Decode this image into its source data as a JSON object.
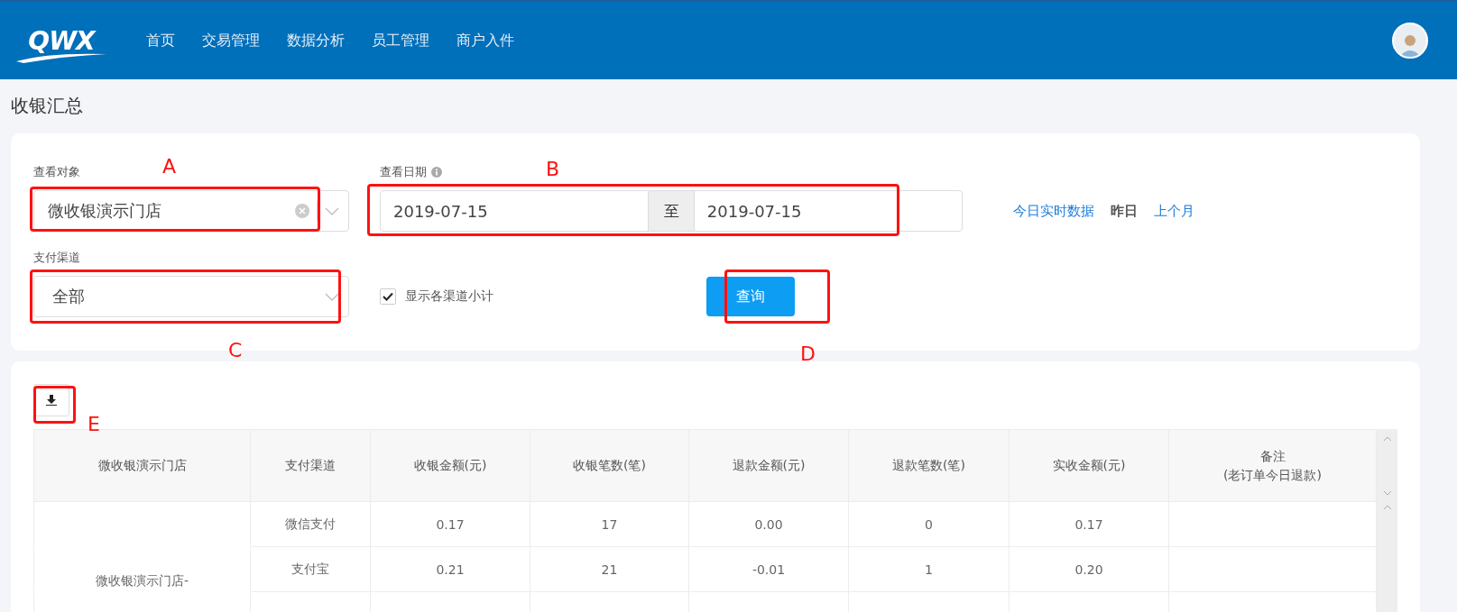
{
  "header": {
    "logo": "QWX",
    "nav": [
      {
        "label": "首页"
      },
      {
        "label": "交易管理"
      },
      {
        "label": "数据分析"
      },
      {
        "label": "员工管理"
      },
      {
        "label": "商户入件"
      }
    ]
  },
  "page_title": "收银汇总",
  "filters": {
    "target": {
      "label": "查看对象",
      "value": "微收银演示门店"
    },
    "date": {
      "label": "查看日期",
      "start": "2019-07-15",
      "separator": "至",
      "end": "2019-07-15"
    },
    "quick_ranges": [
      {
        "label": "今日实时数据",
        "selected": false
      },
      {
        "label": "昨日",
        "selected": true
      },
      {
        "label": "上个月",
        "selected": false
      }
    ],
    "channel": {
      "label": "支付渠道",
      "value": "全部"
    },
    "show_subtotals": {
      "label": "显示各渠道小计",
      "checked": true
    },
    "query_button": "查询"
  },
  "annotations": [
    {
      "label": "A"
    },
    {
      "label": "B"
    },
    {
      "label": "C"
    },
    {
      "label": "D"
    },
    {
      "label": "E"
    }
  ],
  "table": {
    "columns": [
      "微收银演示门店",
      "支付渠道",
      "收银金额(元)",
      "收银笔数(笔)",
      "退款金额(元)",
      "退款笔数(笔)",
      "实收金额(元)",
      "备注\n(老订单今日退款)"
    ],
    "rows": [
      [
        "",
        "微信支付",
        "0.17",
        "17",
        "0.00",
        "0",
        "0.17",
        ""
      ],
      [
        "微收银演示门店-",
        "支付宝",
        "0.21",
        "21",
        "-0.01",
        "1",
        "0.20",
        ""
      ],
      [
        "",
        "",
        "",
        "",
        "",
        "",
        "",
        ""
      ]
    ]
  }
}
